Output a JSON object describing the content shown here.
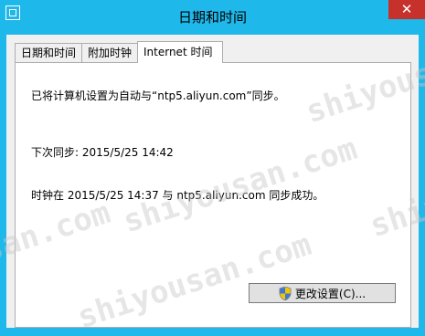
{
  "window": {
    "title": "日期和时间",
    "close_label": "✕"
  },
  "tabs": [
    {
      "label": "日期和时间",
      "active": false
    },
    {
      "label": "附加时钟",
      "active": false
    },
    {
      "label": "Internet 时间",
      "active": true
    }
  ],
  "panel": {
    "sync_setting": "已将计算机设置为自动与“ntp5.aliyun.com”同步。",
    "next_sync": "下次同步: 2015/5/25 14:42",
    "last_sync": "时钟在 2015/5/25 14:37 与 ntp5.aliyun.com 同步成功。"
  },
  "buttons": {
    "change_settings_label": "更改设置(C)..."
  },
  "icons": {
    "app": "clock-icon",
    "button": "uac-shield-icon"
  },
  "watermark": {
    "text": "shiyousan.com"
  },
  "colors": {
    "titlebar": "#1fb8ea",
    "close": "#c7312b",
    "client": "#f0f0f0"
  }
}
